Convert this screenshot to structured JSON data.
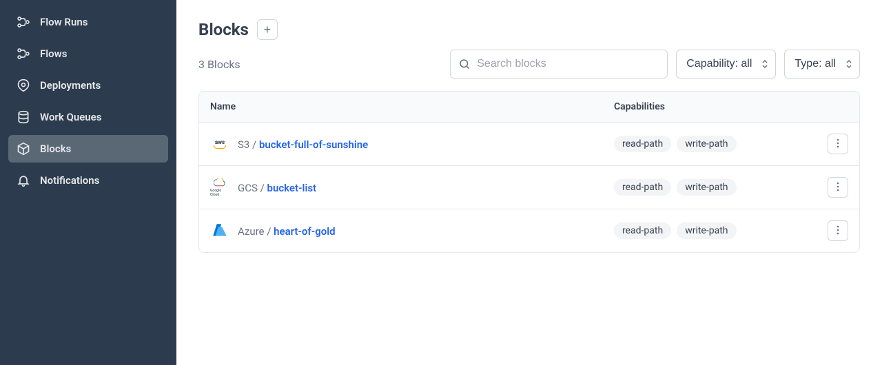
{
  "sidebar": {
    "items": [
      {
        "label": "Flow Runs",
        "icon": "flow-runs"
      },
      {
        "label": "Flows",
        "icon": "flows"
      },
      {
        "label": "Deployments",
        "icon": "deployments"
      },
      {
        "label": "Work Queues",
        "icon": "work-queues"
      },
      {
        "label": "Blocks",
        "icon": "blocks",
        "active": true
      },
      {
        "label": "Notifications",
        "icon": "notifications"
      }
    ]
  },
  "header": {
    "title": "Blocks",
    "add_label": "+"
  },
  "toolbar": {
    "count": "3 Blocks",
    "search_placeholder": "Search blocks",
    "capability_filter": "Capability: all",
    "type_filter": "Type: all"
  },
  "table": {
    "columns": {
      "name": "Name",
      "capabilities": "Capabilities"
    },
    "rows": [
      {
        "icon": "aws",
        "prefix": "S3 / ",
        "name": "bucket-full-of-sunshine",
        "capabilities": [
          "read-path",
          "write-path"
        ]
      },
      {
        "icon": "gcs",
        "prefix": "GCS / ",
        "name": "bucket-list",
        "capabilities": [
          "read-path",
          "write-path"
        ]
      },
      {
        "icon": "azure",
        "prefix": "Azure / ",
        "name": "heart-of-gold",
        "capabilities": [
          "read-path",
          "write-path"
        ]
      }
    ]
  }
}
